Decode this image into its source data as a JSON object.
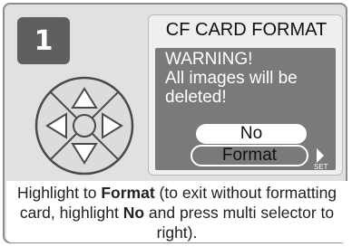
{
  "step": {
    "number": "1"
  },
  "screen": {
    "title": "CF CARD FORMAT",
    "warning_lines": [
      "WARNING!",
      "All images will be",
      "deleted!"
    ],
    "options": [
      "No",
      "Format"
    ],
    "set_label": "SET"
  },
  "multi_selector": {
    "icon": "multi-selector-dpad-icon",
    "directions": [
      "up",
      "right",
      "down",
      "left"
    ]
  },
  "caption": {
    "part1": "Highlight to ",
    "bold1": "Format",
    "part2": " (to exit without formatting card, highlight ",
    "bold2": "No",
    "part3": " and press multi selector to right)."
  },
  "colors": {
    "panel_bg": "#e1e1e1",
    "badge_bg": "#5f5f5f",
    "screen_body": "#7a7a7a"
  }
}
